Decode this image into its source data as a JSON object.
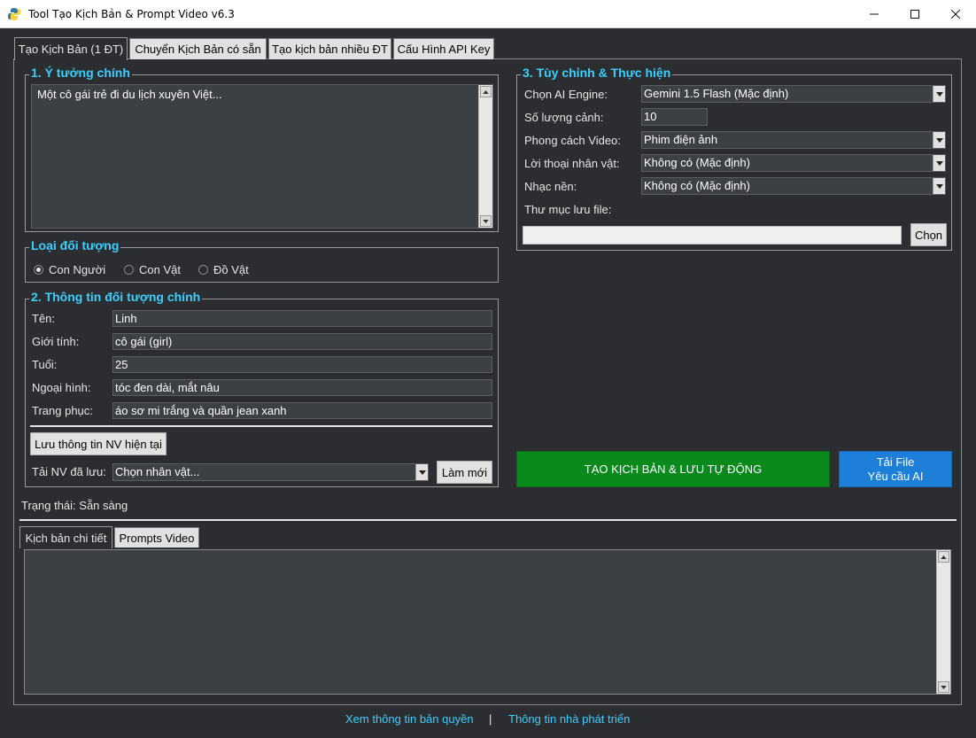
{
  "window": {
    "title": "Tool Tạo Kịch Bản & Prompt Video v6.3",
    "controls": {
      "minimize": "—",
      "maximize": "☐",
      "close": "✕"
    }
  },
  "tabs": [
    {
      "label": "Tạo Kịch Bản (1 ĐT)",
      "active": true
    },
    {
      "label": "Chuyển Kịch Bản có sẵn",
      "active": false
    },
    {
      "label": "Tạo kịch bản nhiều ĐT",
      "active": false
    },
    {
      "label": "Cấu Hình API Key",
      "active": false
    }
  ],
  "idea": {
    "legend": "1. Ý tưởng chính",
    "text": "Một cô gái trẻ đi du lịch xuyên Việt..."
  },
  "object_type": {
    "legend": "Loại đối tượng",
    "options": [
      {
        "label": "Con Người",
        "selected": true
      },
      {
        "label": "Con Vật",
        "selected": false
      },
      {
        "label": "Đồ Vật",
        "selected": false
      }
    ]
  },
  "subject": {
    "legend": "2. Thông tin đối tượng chính",
    "fields": [
      {
        "label": "Tên:",
        "value": "Linh"
      },
      {
        "label": "Giới tính:",
        "value": "cô gái (girl)"
      },
      {
        "label": "Tuổi:",
        "value": "25"
      },
      {
        "label": "Ngoại hình:",
        "value": "tóc đen dài, mắt nâu"
      },
      {
        "label": "Trang phục:",
        "value": "áo sơ mi trắng và quần jean xanh"
      }
    ],
    "save_button": "Lưu thông tin NV hiện tại",
    "load_label": "Tải NV đã lưu:",
    "load_value": "Chọn nhân vật...",
    "refresh_button": "Làm mới"
  },
  "settings": {
    "legend": "3. Tùy chỉnh & Thực hiện",
    "rows": [
      {
        "label": "Chọn AI Engine:",
        "value": "Gemini 1.5 Flash (Mặc định)"
      },
      {
        "label": "Số lượng cảnh:",
        "value": "10"
      },
      {
        "label": "Phong cách Video:",
        "value": "Phim điện ảnh"
      },
      {
        "label": "Lời thoại nhân vật:",
        "value": "Không có (Mặc định)"
      },
      {
        "label": "Nhạc nền:",
        "value": "Không có (Mặc định)"
      }
    ],
    "folder_label": "Thư mục lưu file:",
    "folder_value": "",
    "choose_button": "Chọn"
  },
  "actions": {
    "generate_button": "TẠO KỊCH BẢN & LƯU TỰ ĐỘNG",
    "download_line1": "Tải File",
    "download_line2": "Yêu cầu AI",
    "generate_color": "#0a8a1c",
    "download_color": "#1e7fd8"
  },
  "status": {
    "text": "Trạng thái: Sẵn sàng"
  },
  "output_tabs": [
    {
      "label": "Kịch bản chi tiết",
      "active": true
    },
    {
      "label": "Prompts Video",
      "active": false
    }
  ],
  "footer": {
    "copyright_link": "Xem thông tin bản quyền",
    "separator": "|",
    "developer_link": "Thông tin nhà phát triển"
  },
  "colors": {
    "accent": "#39d0ff",
    "background": "#2b2d31"
  }
}
